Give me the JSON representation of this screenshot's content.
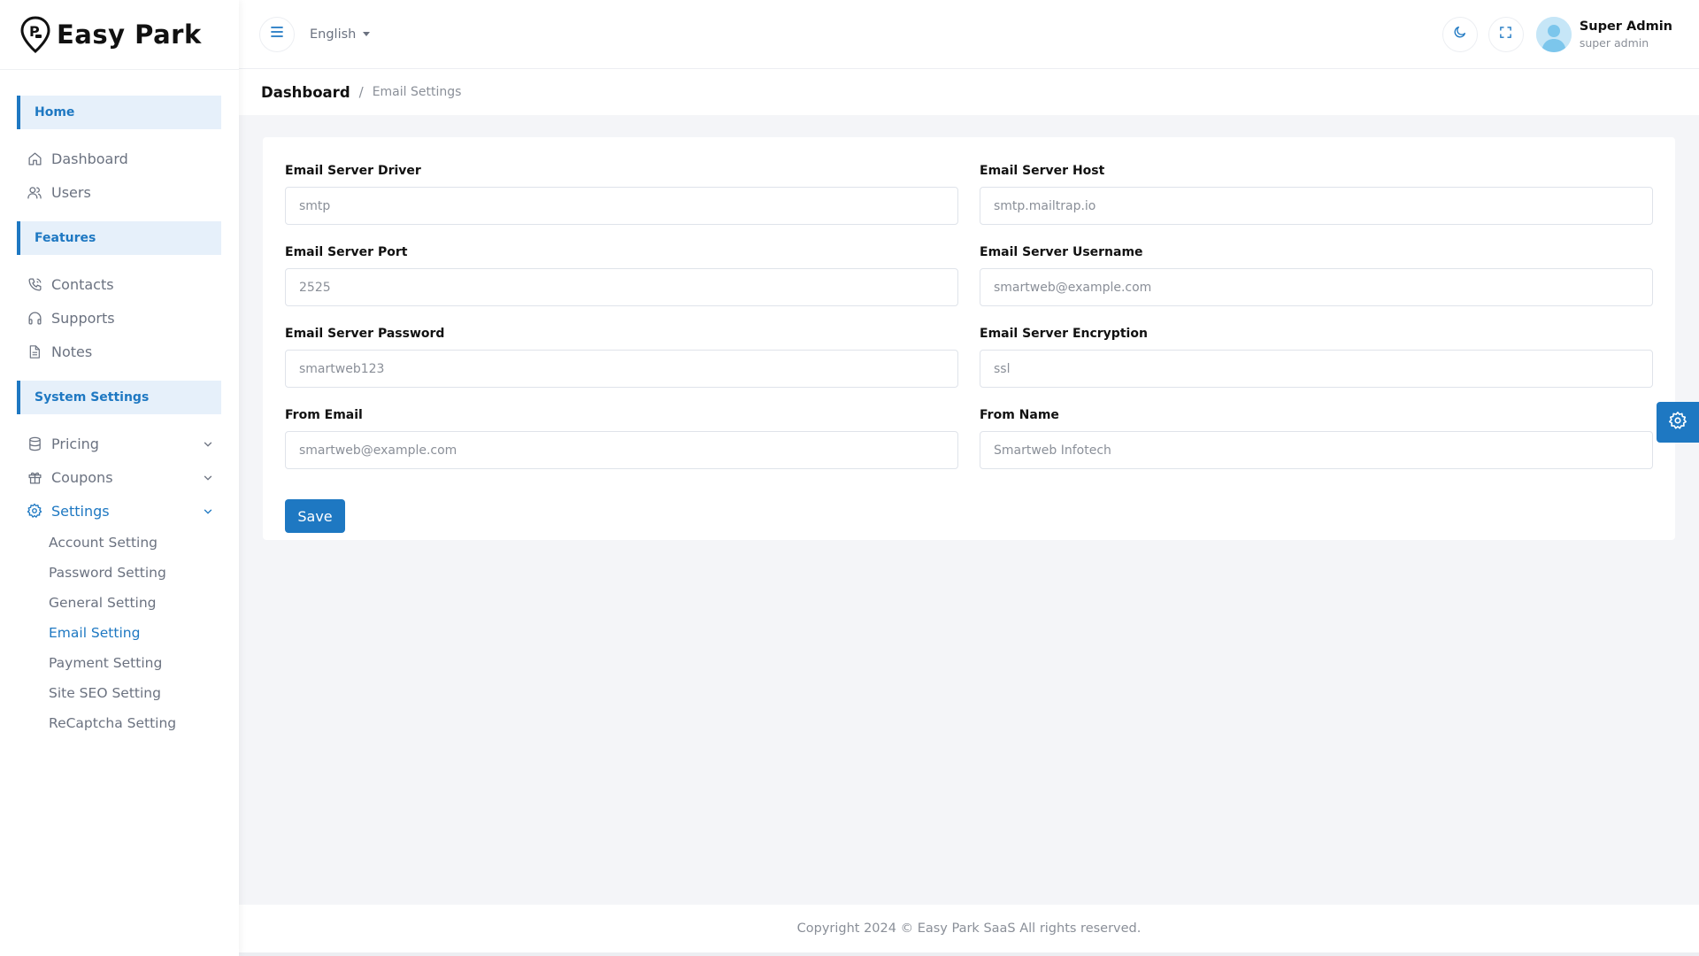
{
  "brand": {
    "name": "Easy Park"
  },
  "sidebar": {
    "sections": [
      {
        "title": "Home",
        "items": [
          {
            "label": "Dashboard",
            "icon": "home-icon"
          },
          {
            "label": "Users",
            "icon": "users-icon"
          }
        ]
      },
      {
        "title": "Features",
        "items": [
          {
            "label": "Contacts",
            "icon": "phone-icon"
          },
          {
            "label": "Supports",
            "icon": "headphones-icon"
          },
          {
            "label": "Notes",
            "icon": "file-text-icon"
          }
        ]
      },
      {
        "title": "System Settings",
        "items": [
          {
            "label": "Pricing",
            "icon": "database-icon",
            "expandable": true
          },
          {
            "label": "Coupons",
            "icon": "gift-icon",
            "expandable": true
          },
          {
            "label": "Settings",
            "icon": "gear-icon",
            "expandable": true,
            "active": true
          }
        ]
      }
    ],
    "settings_sub": [
      "Account Setting",
      "Password Setting",
      "General Setting",
      "Email Setting",
      "Payment Setting",
      "Site SEO Setting",
      "ReCaptcha Setting"
    ],
    "active_sub": "Email Setting"
  },
  "header": {
    "language": "English",
    "user_name": "Super Admin",
    "user_role": "super admin"
  },
  "breadcrumb": {
    "root": "Dashboard",
    "separator": "/",
    "current": "Email Settings"
  },
  "form": {
    "fields": [
      {
        "label": "Email Server Driver",
        "value": "smtp"
      },
      {
        "label": "Email Server Host",
        "value": "smtp.mailtrap.io"
      },
      {
        "label": "Email Server Port",
        "value": "2525"
      },
      {
        "label": "Email Server Username",
        "value": "smartweb@example.com"
      },
      {
        "label": "Email Server Password",
        "value": "smartweb123"
      },
      {
        "label": "Email Server Encryption",
        "value": "ssl"
      },
      {
        "label": "From Email",
        "value": "smartweb@example.com"
      },
      {
        "label": "From Name",
        "value": "Smartweb Infotech"
      }
    ],
    "save_label": "Save"
  },
  "footer": {
    "text": "Copyright 2024 © Easy Park SaaS All rights reserved."
  },
  "colors": {
    "accent": "#1e78c2",
    "section_bg": "#e6f0fa",
    "page_bg": "#f4f5f8"
  }
}
